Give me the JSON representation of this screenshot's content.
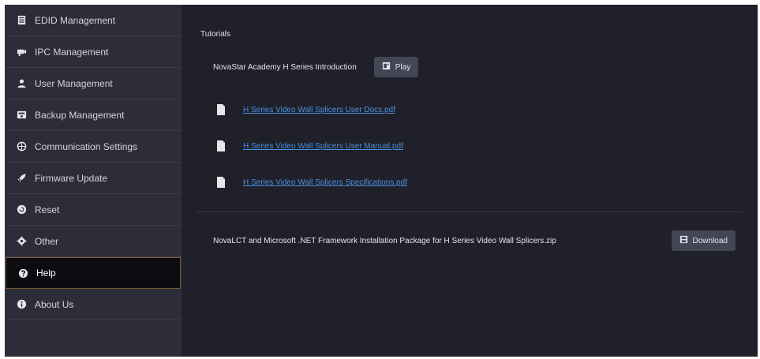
{
  "sidebar": {
    "items": [
      {
        "label": "EDID Management",
        "icon": "table-icon"
      },
      {
        "label": "IPC Management",
        "icon": "camera-icon"
      },
      {
        "label": "User Management",
        "icon": "user-icon"
      },
      {
        "label": "Backup Management",
        "icon": "backup-icon"
      },
      {
        "label": "Communication Settings",
        "icon": "globe-icon"
      },
      {
        "label": "Firmware Update",
        "icon": "rocket-icon"
      },
      {
        "label": "Reset",
        "icon": "reset-icon"
      },
      {
        "label": "Other",
        "icon": "gear-icon"
      },
      {
        "label": "Help",
        "icon": "question-icon",
        "active": true
      },
      {
        "label": "About Us",
        "icon": "info-icon"
      }
    ]
  },
  "main": {
    "tutorials_title": "Tutorials",
    "intro_label": "NovaStar Academy H Series Introduction",
    "play_label": "Play",
    "files": [
      "H Series Video Wall Splicers User Docs.pdf",
      "H Series Video Wall Splicers User Manual.pdf",
      "H Series Video Wall Splicers Specifications.pdf"
    ],
    "download_text": "NovaLCT and Microsoft .NET Framework Installation Package for H Series Video Wall Splicers.zip",
    "download_label": "Download"
  },
  "colors": {
    "sidebar_bg": "#2c2d38",
    "content_bg": "#1f2029",
    "active_bg": "#0c0c10",
    "active_border": "#7a5a35",
    "link": "#4a90e2",
    "button_bg": "#444655"
  }
}
